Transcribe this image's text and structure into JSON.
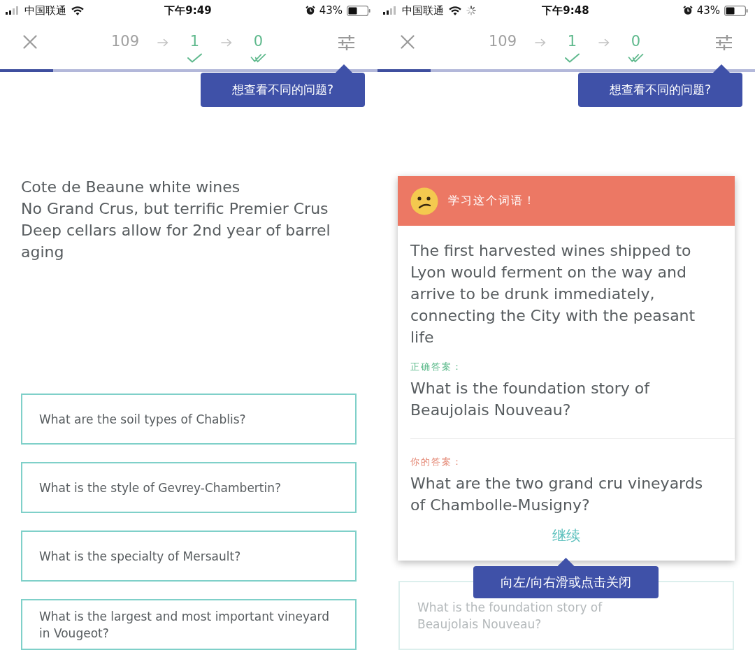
{
  "screens": [
    {
      "status_bar": {
        "carrier": "中国联通",
        "loading": false,
        "time": "下午9:49",
        "battery": "43%"
      },
      "header": {
        "counts": [
          {
            "kind": "plain",
            "value": "109"
          },
          {
            "kind": "check",
            "value": "1"
          },
          {
            "kind": "double-check",
            "value": "0"
          }
        ]
      },
      "progress": {
        "level": 0.14
      },
      "tooltip": "想查看不同的问题?",
      "prompt": [
        "Cote de Beaune white wines",
        "No Grand Crus, but terrific Premier Crus",
        "Deep cellars allow for 2nd year of barrel aging"
      ],
      "options": [
        {
          "text": "What are the soil types of Chablis?",
          "faded": false
        },
        {
          "text": "What is the style of Gevrey-Chambertin?",
          "faded": false
        },
        {
          "text": "What is the specialty of Mersault?",
          "faded": false
        },
        {
          "text": "What is the largest and most important vineyard in Vougeot?",
          "faded": false
        }
      ]
    },
    {
      "status_bar": {
        "carrier": "中国联通",
        "loading": true,
        "time": "下午9:48",
        "battery": "43%"
      },
      "header": {
        "counts": [
          {
            "kind": "plain",
            "value": "109"
          },
          {
            "kind": "check",
            "value": "1"
          },
          {
            "kind": "double-check",
            "value": "0"
          }
        ]
      },
      "progress": {
        "level": 0.14
      },
      "tooltip": "想查看不同的问题?",
      "feedback_card": {
        "title": "学习这个词语！",
        "prompt": "The first harvested wines shipped to Lyon would ferment on the way and arrive to be drunk immediately, connecting the City with the peasant life",
        "correct_label": "正确答案：",
        "correct_answer": "What is the foundation story of Beaujolais Nouveau?",
        "your_label": "你的答案：",
        "your_answer": "What are the two grand cru vineyards of Chambolle-Musigny?",
        "continue_button": "继续"
      },
      "hint_tooltip": "向左/向右滑或点击关闭",
      "options": [
        {
          "text": "What is the foundation story of Beaujolais Nouveau?",
          "faded": true
        }
      ]
    }
  ]
}
